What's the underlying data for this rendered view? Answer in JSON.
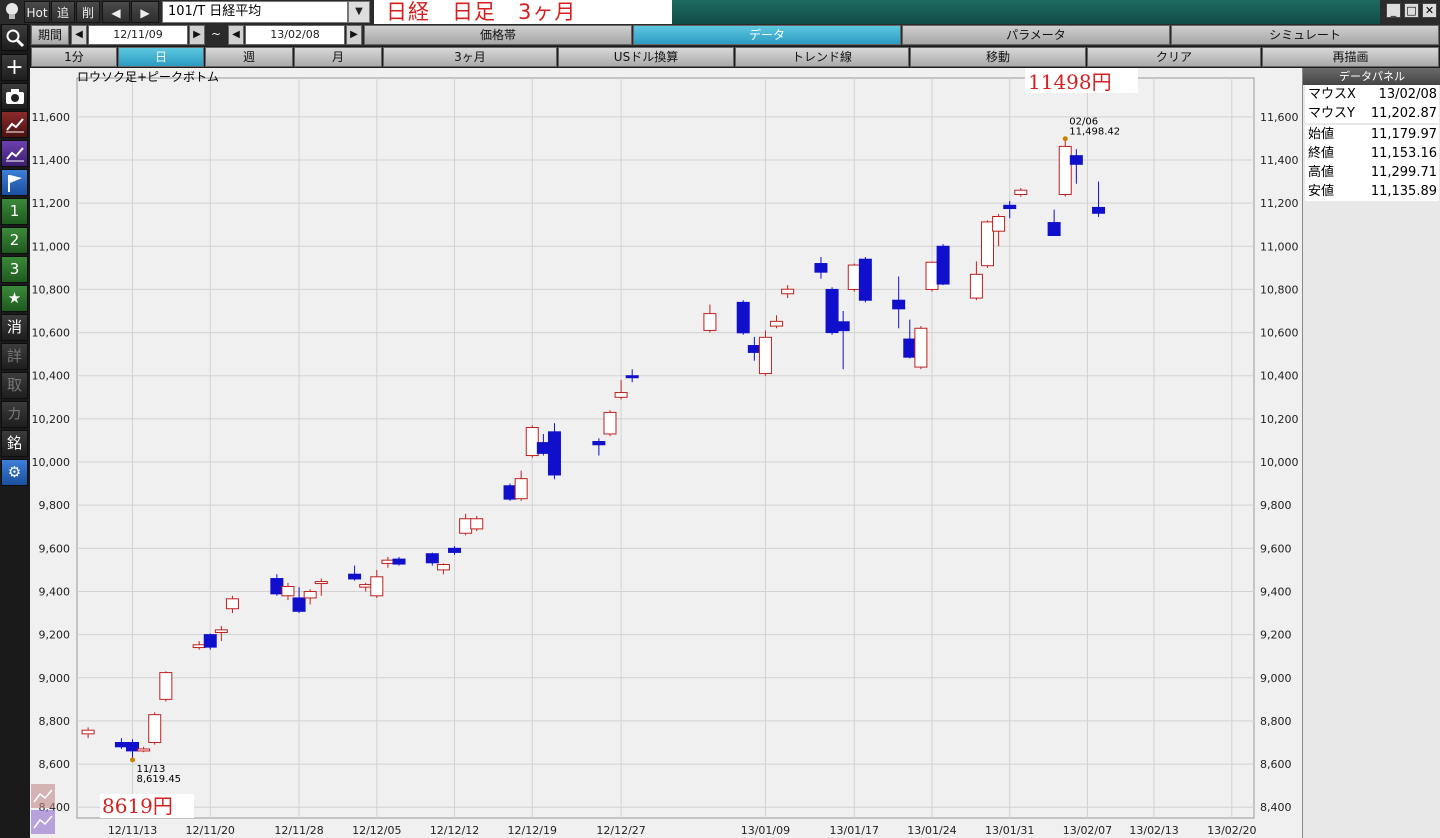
{
  "topbar": {
    "hot_label": "Hot",
    "add_label": "追",
    "delete_label": "削",
    "symbol": "101/T 日経平均",
    "title": "日経　日足　3ヶ月"
  },
  "period": {
    "label": "期間",
    "from": "12/11/09",
    "tilde": "~",
    "to": "13/02/08"
  },
  "tabs": [
    {
      "label": "価格帯",
      "active": false
    },
    {
      "label": "データ",
      "active": true
    },
    {
      "label": "パラメータ",
      "active": false
    },
    {
      "label": "シミュレート",
      "active": false
    }
  ],
  "timeframes": [
    {
      "label": "1分",
      "active": false
    },
    {
      "label": "日",
      "active": true
    },
    {
      "label": "週",
      "active": false
    },
    {
      "label": "月",
      "active": false
    },
    {
      "label": "3ヶ月",
      "active": false
    }
  ],
  "actions": [
    "USドル換算",
    "トレンド線",
    "移動",
    "クリア",
    "再描画"
  ],
  "left_toolbar": [
    "1",
    "2",
    "3",
    "消",
    "詳",
    "取",
    "カ",
    "銘"
  ],
  "data_panel": {
    "title": "データパネル",
    "rows": [
      {
        "key": "マウスX",
        "value": "13/02/08"
      },
      {
        "key": "マウスY",
        "value": "11,202.87"
      },
      {
        "key": "始値",
        "value": "11,179.97"
      },
      {
        "key": "終値",
        "value": "11,153.16"
      },
      {
        "key": "高値",
        "value": "11,299.71"
      },
      {
        "key": "安値",
        "value": "11,135.89"
      }
    ]
  },
  "colors": {
    "up": "#c02020",
    "down": "#1010cc",
    "marker": "#d08000",
    "accent": "#2a9cc2"
  },
  "chart_data": {
    "type": "candlestick",
    "title": "ロウソク足+ピークボトム",
    "ylim": [
      8350,
      11780
    ],
    "yticks": [
      8400,
      8600,
      8800,
      9000,
      9200,
      9400,
      9600,
      9800,
      10000,
      10200,
      10400,
      10600,
      10800,
      11000,
      11200,
      11400,
      11600
    ],
    "ytick_labels": [
      "8,400",
      "8,600",
      "8,800",
      "9,000",
      "9,200",
      "9,400",
      "9,600",
      "9,800",
      "10,000",
      "10,200",
      "10,400",
      "10,600",
      "10,800",
      "11,000",
      "11,200",
      "11,400",
      "11,600"
    ],
    "xlim": [
      "12/11/08",
      "13/02/22"
    ],
    "xticks": [
      "12/11/13",
      "12/11/20",
      "12/11/28",
      "12/12/05",
      "12/12/12",
      "12/12/19",
      "12/12/27",
      "13/01/09",
      "13/01/17",
      "13/01/24",
      "13/01/31",
      "13/02/07",
      "13/02/13",
      "13/02/20"
    ],
    "candles": [
      {
        "date": "12/11/09",
        "o": 8740,
        "h": 8770,
        "l": 8720,
        "c": 8757
      },
      {
        "date": "12/11/12",
        "o": 8700,
        "h": 8720,
        "l": 8670,
        "c": 8680
      },
      {
        "date": "12/11/13",
        "o": 8700,
        "h": 8715,
        "l": 8619,
        "c": 8661
      },
      {
        "date": "12/11/14",
        "o": 8661,
        "h": 8680,
        "l": 8655,
        "c": 8670
      },
      {
        "date": "12/11/15",
        "o": 8700,
        "h": 8840,
        "l": 8690,
        "c": 8829
      },
      {
        "date": "12/11/16",
        "o": 8900,
        "h": 9030,
        "l": 8890,
        "c": 9024
      },
      {
        "date": "12/11/19",
        "o": 9140,
        "h": 9170,
        "l": 9130,
        "c": 9153
      },
      {
        "date": "12/11/20",
        "o": 9200,
        "h": 9205,
        "l": 9130,
        "c": 9142
      },
      {
        "date": "12/11/21",
        "o": 9210,
        "h": 9240,
        "l": 9170,
        "c": 9222
      },
      {
        "date": "12/11/22",
        "o": 9320,
        "h": 9380,
        "l": 9300,
        "c": 9366
      },
      {
        "date": "12/11/26",
        "o": 9460,
        "h": 9480,
        "l": 9380,
        "c": 9389
      },
      {
        "date": "12/11/27",
        "o": 9380,
        "h": 9440,
        "l": 9360,
        "c": 9423
      },
      {
        "date": "12/11/28",
        "o": 9370,
        "h": 9420,
        "l": 9300,
        "c": 9308
      },
      {
        "date": "12/11/29",
        "o": 9370,
        "h": 9410,
        "l": 9340,
        "c": 9400
      },
      {
        "date": "12/11/30",
        "o": 9440,
        "h": 9460,
        "l": 9380,
        "c": 9446
      },
      {
        "date": "12/12/03",
        "o": 9480,
        "h": 9520,
        "l": 9450,
        "c": 9458
      },
      {
        "date": "12/12/04",
        "o": 9420,
        "h": 9440,
        "l": 9400,
        "c": 9432
      },
      {
        "date": "12/12/05",
        "o": 9380,
        "h": 9500,
        "l": 9370,
        "c": 9468
      },
      {
        "date": "12/12/06",
        "o": 9530,
        "h": 9560,
        "l": 9510,
        "c": 9545
      },
      {
        "date": "12/12/07",
        "o": 9550,
        "h": 9560,
        "l": 9520,
        "c": 9527
      },
      {
        "date": "12/12/10",
        "o": 9575,
        "h": 9580,
        "l": 9520,
        "c": 9533
      },
      {
        "date": "12/12/11",
        "o": 9500,
        "h": 9530,
        "l": 9480,
        "c": 9525
      },
      {
        "date": "12/12/12",
        "o": 9600,
        "h": 9610,
        "l": 9570,
        "c": 9581
      },
      {
        "date": "12/12/13",
        "o": 9670,
        "h": 9760,
        "l": 9660,
        "c": 9737
      },
      {
        "date": "12/12/14",
        "o": 9690,
        "h": 9750,
        "l": 9680,
        "c": 9737
      },
      {
        "date": "12/12/17",
        "o": 9890,
        "h": 9900,
        "l": 9820,
        "c": 9828
      },
      {
        "date": "12/12/18",
        "o": 9830,
        "h": 9960,
        "l": 9820,
        "c": 9923
      },
      {
        "date": "12/12/19",
        "o": 10030,
        "h": 10170,
        "l": 10020,
        "c": 10160
      },
      {
        "date": "12/12/20",
        "o": 10090,
        "h": 10130,
        "l": 10030,
        "c": 10040
      },
      {
        "date": "12/12/21",
        "o": 10140,
        "h": 10180,
        "l": 9920,
        "c": 9940
      },
      {
        "date": "12/12/25",
        "o": 10095,
        "h": 10110,
        "l": 10030,
        "c": 10080
      },
      {
        "date": "12/12/26",
        "o": 10130,
        "h": 10240,
        "l": 10120,
        "c": 10230
      },
      {
        "date": "12/12/27",
        "o": 10300,
        "h": 10380,
        "l": 10290,
        "c": 10322
      },
      {
        "date": "12/12/28",
        "o": 10400,
        "h": 10430,
        "l": 10370,
        "c": 10395
      },
      {
        "date": "13/01/04",
        "o": 10610,
        "h": 10730,
        "l": 10600,
        "c": 10688
      },
      {
        "date": "13/01/07",
        "o": 10740,
        "h": 10750,
        "l": 10590,
        "c": 10599
      },
      {
        "date": "13/01/08",
        "o": 10540,
        "h": 10580,
        "l": 10470,
        "c": 10508
      },
      {
        "date": "13/01/09",
        "o": 10410,
        "h": 10610,
        "l": 10400,
        "c": 10578
      },
      {
        "date": "13/01/10",
        "o": 10630,
        "h": 10680,
        "l": 10620,
        "c": 10652
      },
      {
        "date": "13/01/11",
        "o": 10780,
        "h": 10820,
        "l": 10760,
        "c": 10801
      },
      {
        "date": "13/01/14",
        "o": 10920,
        "h": 10950,
        "l": 10850,
        "c": 10880
      },
      {
        "date": "13/01/15",
        "o": 10800,
        "h": 10810,
        "l": 10590,
        "c": 10600
      },
      {
        "date": "13/01/16",
        "o": 10650,
        "h": 10700,
        "l": 10430,
        "c": 10609
      },
      {
        "date": "13/01/17",
        "o": 10800,
        "h": 10920,
        "l": 10790,
        "c": 10913
      },
      {
        "date": "13/01/18",
        "o": 10940,
        "h": 10950,
        "l": 10740,
        "c": 10750
      },
      {
        "date": "13/01/21",
        "o": 10750,
        "h": 10860,
        "l": 10620,
        "c": 10710
      },
      {
        "date": "13/01/22",
        "o": 10570,
        "h": 10660,
        "l": 10480,
        "c": 10486
      },
      {
        "date": "13/01/23",
        "o": 10440,
        "h": 10630,
        "l": 10430,
        "c": 10620
      },
      {
        "date": "13/01/24",
        "o": 10800,
        "h": 10930,
        "l": 10790,
        "c": 10926
      },
      {
        "date": "13/01/25",
        "o": 11000,
        "h": 11010,
        "l": 10820,
        "c": 10825
      },
      {
        "date": "13/01/28",
        "o": 10760,
        "h": 10930,
        "l": 10750,
        "c": 10870
      },
      {
        "date": "13/01/29",
        "o": 10910,
        "h": 11120,
        "l": 10900,
        "c": 11113
      },
      {
        "date": "13/01/30",
        "o": 11070,
        "h": 11150,
        "l": 11000,
        "c": 11138
      },
      {
        "date": "13/01/31",
        "o": 11190,
        "h": 11210,
        "l": 11130,
        "c": 11175
      },
      {
        "date": "13/02/01",
        "o": 11240,
        "h": 11270,
        "l": 11230,
        "c": 11260
      },
      {
        "date": "13/02/04",
        "o": 11110,
        "h": 11170,
        "l": 11050,
        "c": 11050
      },
      {
        "date": "13/02/05",
        "o": 11240,
        "h": 11490,
        "l": 11230,
        "c": 11463
      },
      {
        "date": "13/02/06",
        "o": 11420,
        "h": 11450,
        "l": 11290,
        "c": 11380
      },
      {
        "date": "13/02/08",
        "o": 11180,
        "h": 11300,
        "l": 11136,
        "c": 11153
      }
    ],
    "annotations": [
      {
        "text": "11/13",
        "date": "12/11/13",
        "value": 8619.45
      },
      {
        "text": "8,619.45",
        "date": "12/11/13",
        "value": 8619.45
      },
      {
        "text": "02/06",
        "date": "13/02/05",
        "value": 11498.42
      },
      {
        "text": "11,498.42",
        "date": "13/02/05",
        "value": 11498.42
      }
    ],
    "price_high_label": "11498円",
    "price_low_label": "8619円"
  }
}
